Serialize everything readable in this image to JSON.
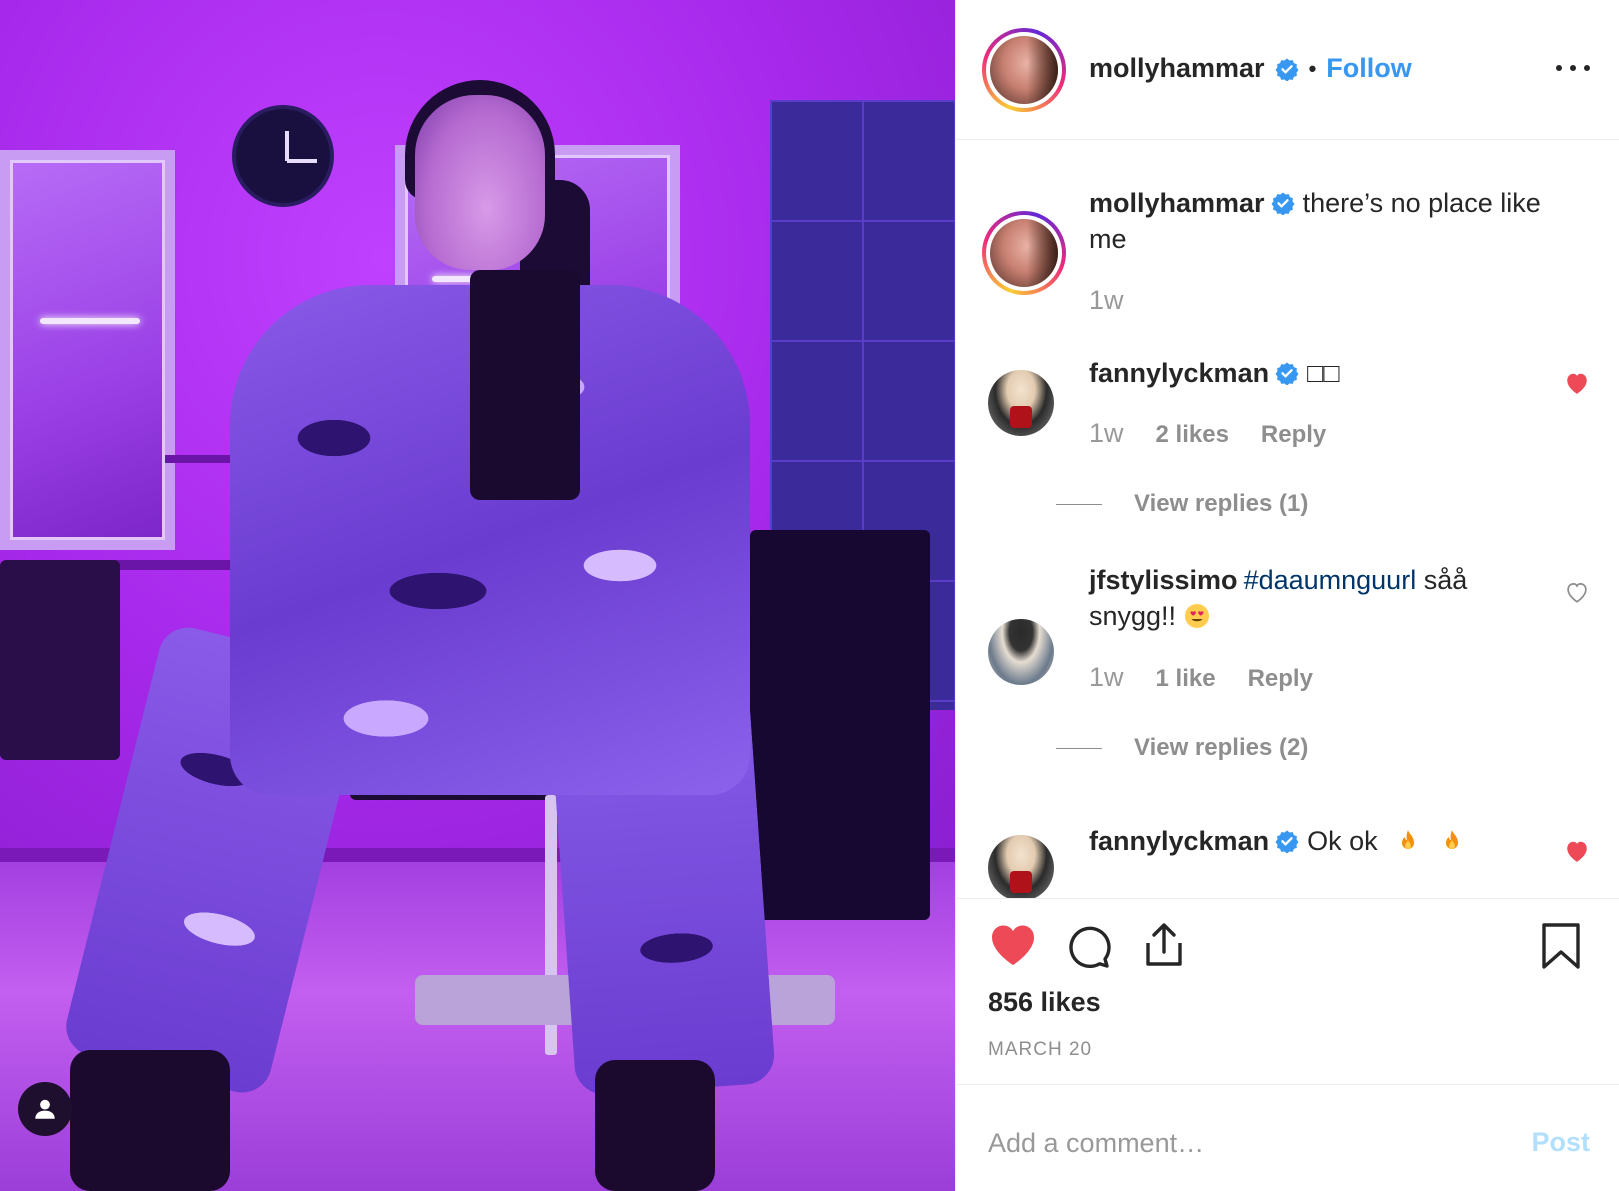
{
  "header": {
    "username": "mollyhammar",
    "separator": "•",
    "follow_label": "Follow"
  },
  "caption": {
    "username": "mollyhammar",
    "text": "there’s no place like me",
    "time": "1w"
  },
  "comments": [
    {
      "username": "fannylyckman",
      "text": "□□",
      "time": "1w",
      "likes": "2 likes",
      "reply_label": "Reply",
      "view_replies": "View replies (1)",
      "liked": true
    },
    {
      "username": "jfstylissimo",
      "hashtag": "#daaumnguurl",
      "text": "såå snygg!!",
      "time": "1w",
      "likes": "1 like",
      "reply_label": "Reply",
      "view_replies": "View replies (2)",
      "liked": false
    },
    {
      "username": "fannylyckman",
      "text": "Ok ok",
      "liked": true
    }
  ],
  "post": {
    "likes": "856 likes",
    "date": "MARCH 20",
    "liked": true
  },
  "add_comment": {
    "placeholder": "Add a comment…",
    "post_label": "Post"
  },
  "colors": {
    "accent": "#3897f0",
    "like_red": "#ed4956",
    "hashtag": "#003569",
    "muted": "#8e8e8e"
  },
  "icons": [
    "verified-badge-icon",
    "more-options-icon",
    "heart-icon",
    "comment-icon",
    "share-icon",
    "bookmark-icon",
    "user-icon",
    "heart-eyes-emoji",
    "fire-emoji"
  ]
}
